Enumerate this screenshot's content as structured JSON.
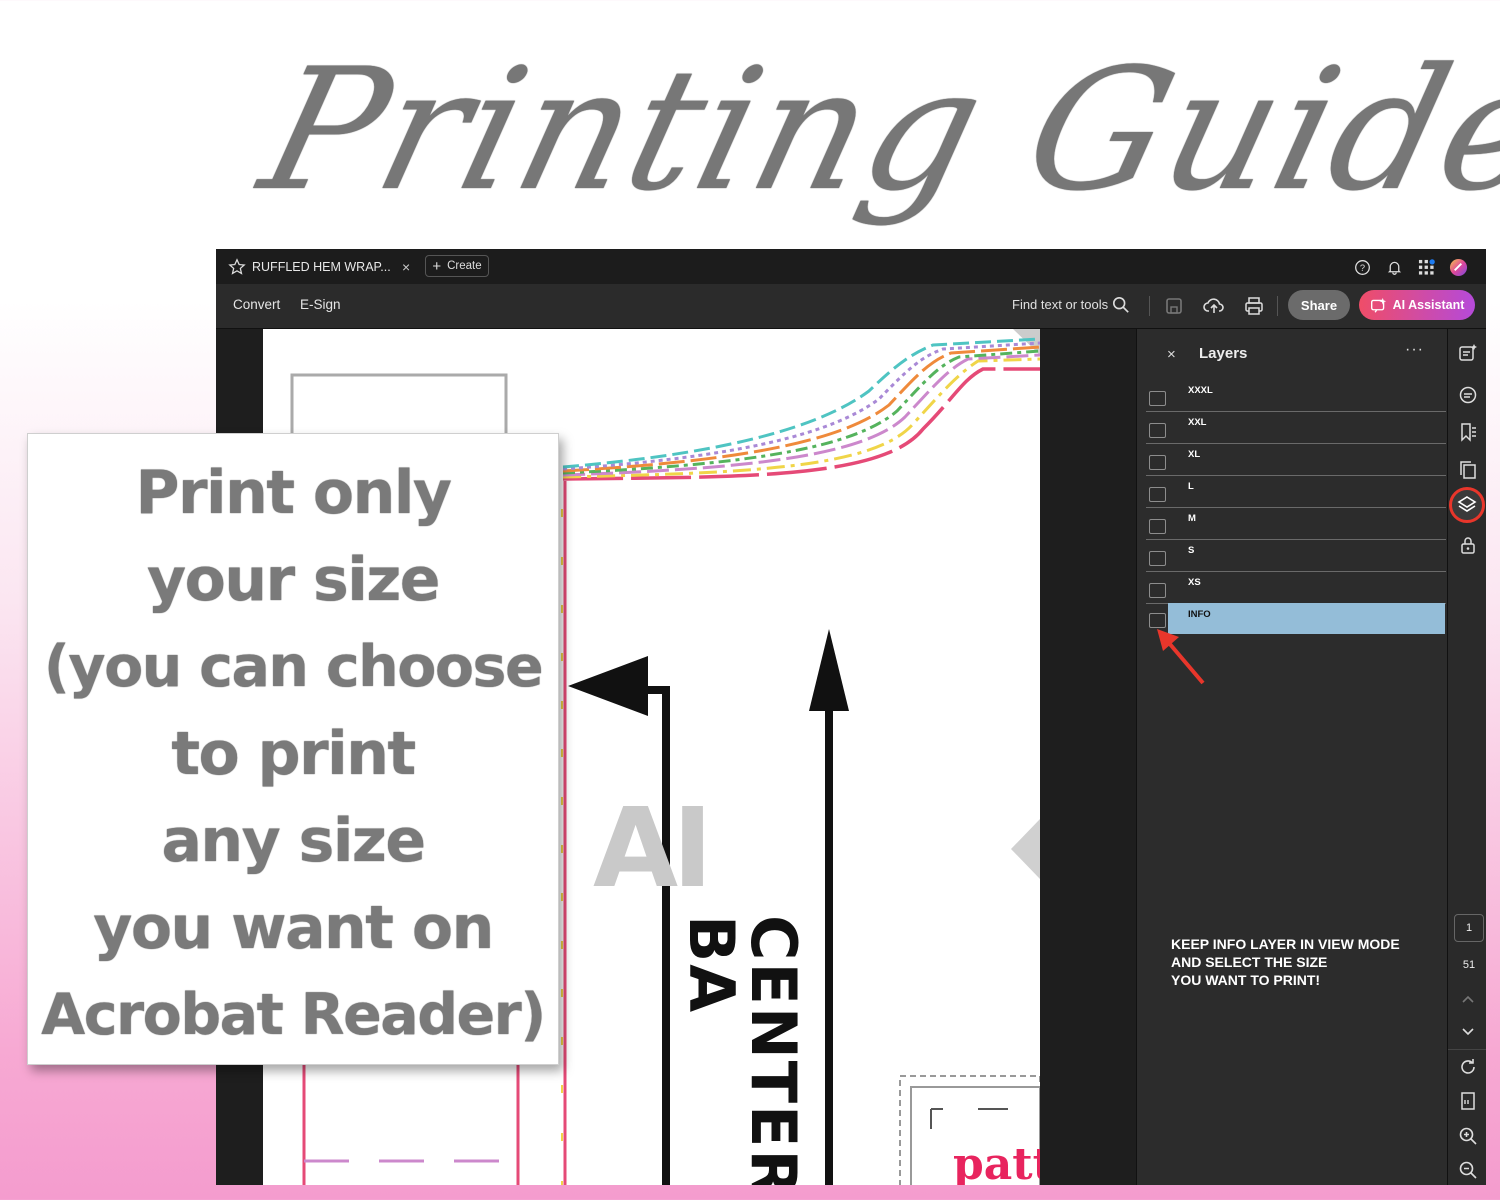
{
  "guide_title": "Printing Guide",
  "app": {
    "tab_title": "RUFFLED HEM WRAP...",
    "tab_close": "×",
    "create_label": "Create",
    "menu": [
      "Convert",
      "E-Sign"
    ],
    "find_label": "Find text or tools",
    "share_label": "Share",
    "ai_label": "AI Assistant"
  },
  "document": {
    "center_text": "CENTER BA",
    "watermark": "AI",
    "pattern_text": "patt"
  },
  "layers_panel": {
    "title": "Layers",
    "close": "×",
    "more": "···",
    "layers": [
      {
        "name": "XXXL"
      },
      {
        "name": "XXL"
      },
      {
        "name": "XL"
      },
      {
        "name": "L"
      },
      {
        "name": "M"
      },
      {
        "name": "S"
      },
      {
        "name": "XS"
      },
      {
        "name": "INFO",
        "selected": true
      }
    ],
    "note_lines": [
      "KEEP INFO LAYER IN VIEW MODE",
      "AND SELECT THE SIZE",
      "YOU WANT TO PRINT!"
    ]
  },
  "page_nav": {
    "current": "1",
    "total": "51"
  },
  "callout_lines": [
    "Print only",
    "your size",
    "(you can choose",
    "to print",
    "any size",
    "you want on",
    "Acrobat Reader)"
  ],
  "colors": {
    "accent_red": "#e8362b",
    "selected_layer": "#94bdd8",
    "ai_gradient_start": "#ef4d68",
    "ai_gradient_end": "#b54ad9"
  }
}
